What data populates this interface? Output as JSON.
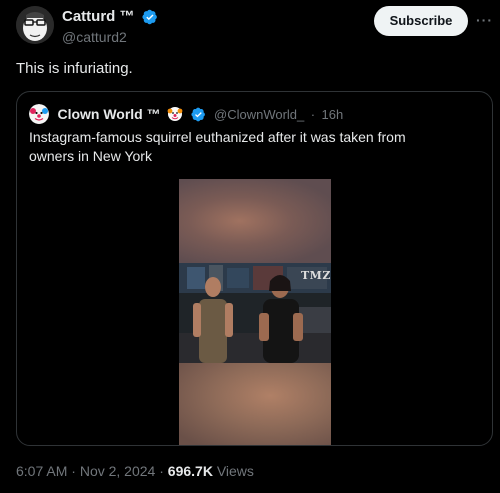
{
  "colors": {
    "background": "#000000",
    "text": "#e7e9ea",
    "muted": "#71767b",
    "verified": "#1d9bf0",
    "border": "#2f3336",
    "subscribe_bg": "#eff3f4"
  },
  "tweet": {
    "author": {
      "display_name": "Catturd ™",
      "handle": "@catturd2",
      "avatar_icon": "cartoon-avatar-icon",
      "verified_icon": "verified-badge-icon"
    },
    "subscribe_label": "Subscribe",
    "more_icon": "more-icon",
    "text": "This is infuriating.",
    "quote": {
      "display_name": "Clown World ™",
      "handle": "@ClownWorld_",
      "separator": "·",
      "time": "16h",
      "avatar_icon": "clown-avatar-icon",
      "emoji_icon": "clown-emoji-icon",
      "verified_icon": "verified-badge-icon",
      "text": "Instagram-famous squirrel euthanized after it was taken from owners in New York",
      "video": {
        "watermark": "TMZ"
      }
    },
    "meta": {
      "time": "6:07 AM",
      "date": "Nov 2, 2024",
      "separator": "·",
      "views_count": "696.7K",
      "views_label": "Views"
    }
  }
}
